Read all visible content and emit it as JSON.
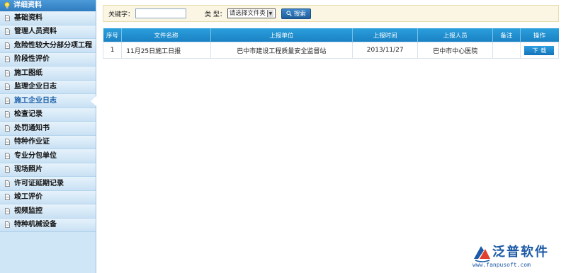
{
  "sidebar": {
    "header": "详细资料",
    "items": [
      {
        "label": "基础资料",
        "active": false
      },
      {
        "label": "管理人员资料",
        "active": false
      },
      {
        "label": "危险性较大分部分项工程",
        "active": false
      },
      {
        "label": "阶段性评价",
        "active": false
      },
      {
        "label": "施工图纸",
        "active": false
      },
      {
        "label": "监理企业日志",
        "active": false
      },
      {
        "label": "施工企业日志",
        "active": true
      },
      {
        "label": "检查记录",
        "active": false
      },
      {
        "label": "处罚通知书",
        "active": false
      },
      {
        "label": "特种作业证",
        "active": false
      },
      {
        "label": "专业分包单位",
        "active": false
      },
      {
        "label": "现场照片",
        "active": false
      },
      {
        "label": "许可证延期记录",
        "active": false
      },
      {
        "label": "竣工评价",
        "active": false
      },
      {
        "label": "视频监控",
        "active": false
      },
      {
        "label": "特种机械设备",
        "active": false
      }
    ]
  },
  "search": {
    "keyword_label": "关键字：",
    "keyword_value": "",
    "type_label": "类 型：",
    "type_selected": "请选择文件类",
    "search_button": "搜索"
  },
  "table": {
    "columns": [
      "序号",
      "文件名称",
      "上报单位",
      "上报时间",
      "上报人员",
      "备注",
      "操作"
    ],
    "rows": [
      {
        "index": "1",
        "file_name": "11月25日施工日报",
        "unit": "巴中市建设工程质量安全监督站",
        "time": "2013/11/27",
        "person": "巴中市中心医院",
        "remark": "",
        "action": "下载"
      }
    ]
  },
  "watermark": {
    "brand": "泛普软件",
    "url": "www.fanpusoft.com"
  },
  "colors": {
    "accent": "#1a82c4",
    "sidebar_bg": "#cfe6f7",
    "search_bg": "#fbf6e4"
  }
}
